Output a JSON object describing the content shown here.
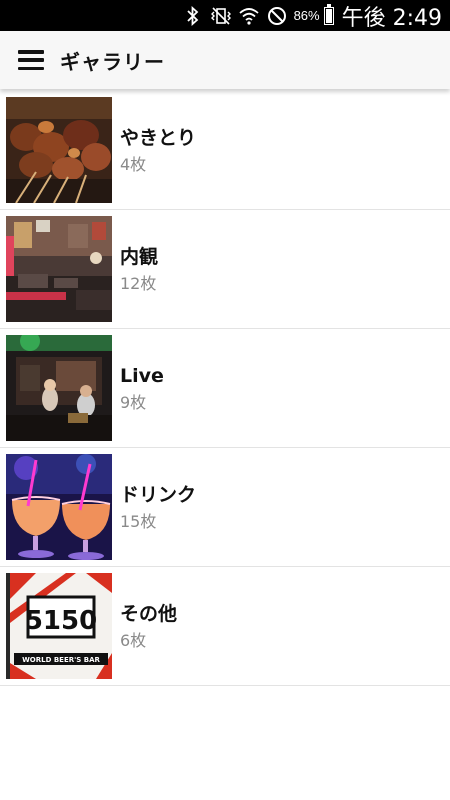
{
  "status_bar": {
    "battery_percent": "86%",
    "battery_level": 0.86,
    "time": "午後 2:49",
    "icons": [
      "bluetooth-icon",
      "vibrate-icon",
      "wifi-icon",
      "do-not-disturb-icon",
      "battery-icon"
    ]
  },
  "app_bar": {
    "menu_icon": "hamburger-menu-icon",
    "title": "ギャラリー"
  },
  "gallery": {
    "items": [
      {
        "title": "やきとり",
        "count": "4枚",
        "thumb": "yakitori-skewers-photo"
      },
      {
        "title": "内観",
        "count": "12枚",
        "thumb": "bar-interior-photo"
      },
      {
        "title": "Live",
        "count": "9枚",
        "thumb": "live-performance-photo"
      },
      {
        "title": "ドリンク",
        "count": "15枚",
        "thumb": "cocktail-drinks-photo"
      },
      {
        "title": "その他",
        "count": "6枚",
        "thumb": "5150-sign-photo"
      }
    ]
  },
  "colors": {
    "status_bar_bg": "#000000",
    "app_bar_bg": "#f7f7f7",
    "title_text": "#111111",
    "count_text": "#8a8a8a",
    "divider": "#e3e3e3"
  }
}
